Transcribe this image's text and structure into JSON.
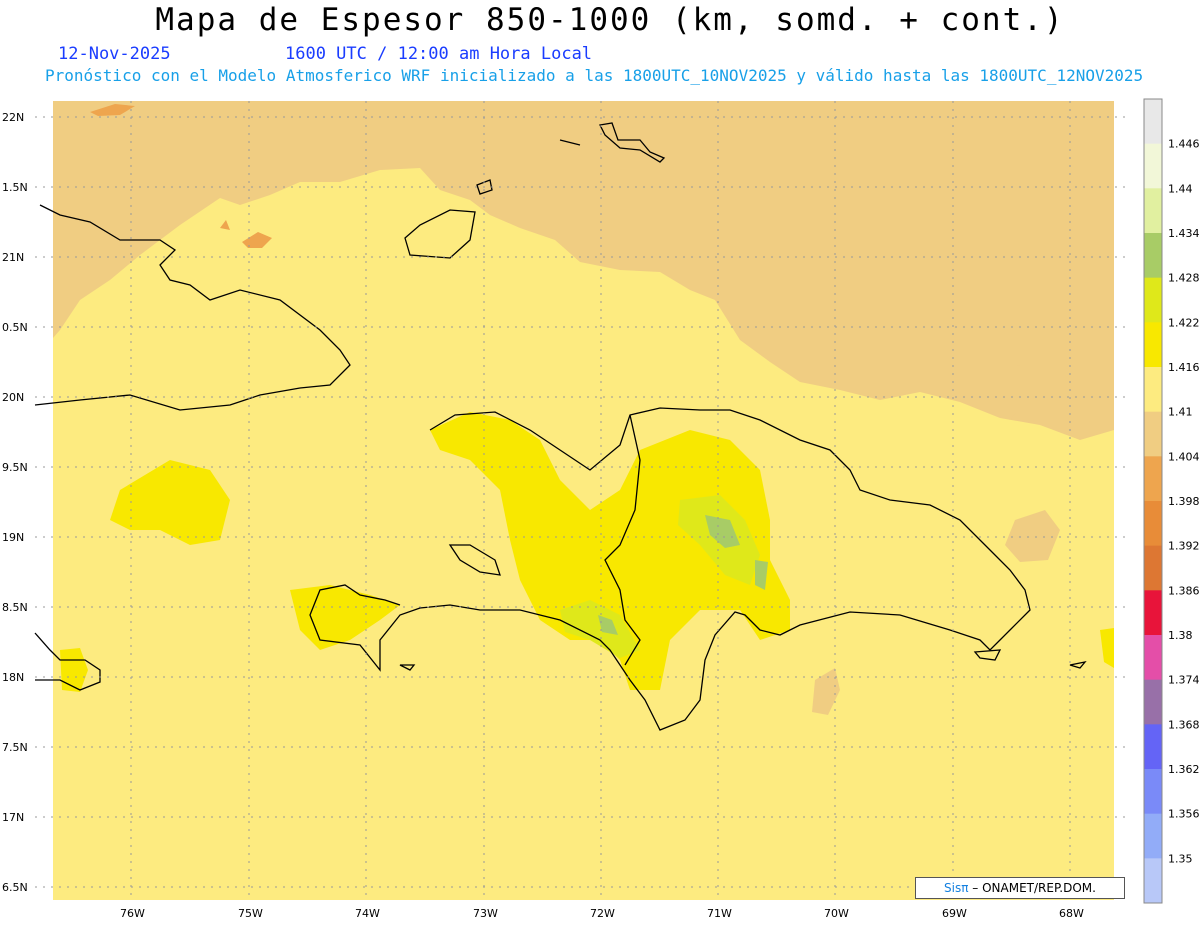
{
  "title": "Mapa de Espesor 850-1000 (km, somd. + cont.)",
  "date": "12-Nov-2025",
  "time": "1600 UTC / 12:00 am Hora Local",
  "forecast": "Pronóstico con el Modelo Atmosferico WRF inicializado a las 1800UTC_10NOV2025 y válido hasta las  1800UTC_12NOV2025",
  "lat_labels": [
    "22N",
    "1.5N",
    "21N",
    "0.5N",
    "20N",
    "9.5N",
    "19N",
    "8.5N",
    "18N",
    "7.5N",
    "17N",
    "6.5N"
  ],
  "lon_labels": [
    "76W",
    "75W",
    "74W",
    "73W",
    "72W",
    "71W",
    "70W",
    "69W",
    "68W"
  ],
  "colorbar": {
    "labels": [
      "1.446",
      "1.44",
      "1.434",
      "1.428",
      "1.422",
      "1.416",
      "1.41",
      "1.404",
      "1.398",
      "1.392",
      "1.386",
      "1.38",
      "1.374",
      "1.368",
      "1.362",
      "1.356",
      "1.35"
    ],
    "colors": [
      "#e8e8e8",
      "#f2f7d8",
      "#e1f0a0",
      "#a8cc66",
      "#dfe81a",
      "#f8e800",
      "#fdeb80",
      "#f0cd82",
      "#eea54e",
      "#e88c38",
      "#dd7733",
      "#e8143a",
      "#e44ea8",
      "#9870a8",
      "#6464f6",
      "#7a8af8",
      "#92acf8",
      "#b8c8f8"
    ]
  },
  "credit": {
    "logo": "Sisπ",
    "text": " – ONAMET/REP.DOM."
  }
}
